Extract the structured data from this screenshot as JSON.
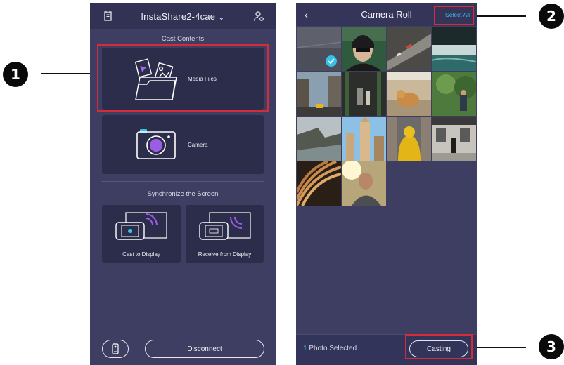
{
  "callouts": [
    "1",
    "2",
    "3"
  ],
  "left_screen": {
    "device_name": "InstaShare2-4cae",
    "cast_contents_label": "Cast Contents",
    "media_files_label": "Media Files",
    "camera_label": "Camera",
    "sync_label": "Synchronize the Screen",
    "cast_to_display_label": "Cast to Display",
    "receive_from_display_label": "Receive from Display",
    "disconnect_label": "Disconnect"
  },
  "right_screen": {
    "title": "Camera Roll",
    "back_icon": "‹",
    "select_all_label": "Select All",
    "selected_count": "1",
    "selected_suffix": "Photo Selected",
    "casting_label": "Casting",
    "photos": [
      {
        "name": "photo-1",
        "selected": true
      },
      {
        "name": "photo-2",
        "selected": false
      },
      {
        "name": "photo-3",
        "selected": false
      },
      {
        "name": "photo-4",
        "selected": false
      },
      {
        "name": "photo-5",
        "selected": false
      },
      {
        "name": "photo-6",
        "selected": false
      },
      {
        "name": "photo-7",
        "selected": false
      },
      {
        "name": "photo-8",
        "selected": false
      },
      {
        "name": "photo-9",
        "selected": false
      },
      {
        "name": "photo-10",
        "selected": false
      },
      {
        "name": "photo-11",
        "selected": false
      },
      {
        "name": "photo-12",
        "selected": false
      },
      {
        "name": "photo-13",
        "selected": false
      },
      {
        "name": "photo-14",
        "selected": false
      }
    ]
  },
  "colors": {
    "background": "#3d3e62",
    "card": "#2c2d4a",
    "accent_cyan": "#35c1e8",
    "accent_purple": "#9b5de5",
    "highlight_red": "#d62b3a"
  }
}
